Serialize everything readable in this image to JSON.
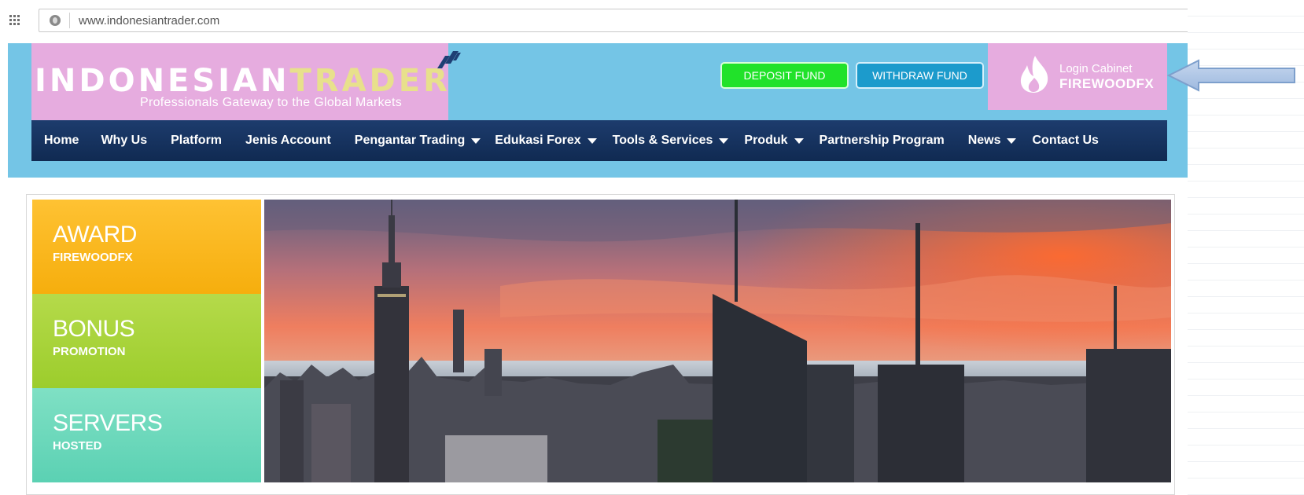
{
  "browser": {
    "url": "www.indonesiantrader.com"
  },
  "header": {
    "logo_part1": "INDONESIAN",
    "logo_part2": "TRADER",
    "tagline": "Professionals Gateway to the Global Markets",
    "deposit_label": "DEPOSIT FUND",
    "withdraw_label": "WITHDRAW FUND",
    "login_line1": "Login Cabinet",
    "login_line2": "FIREWOODFX"
  },
  "nav": {
    "items": [
      {
        "label": "Home"
      },
      {
        "label": "Why Us"
      },
      {
        "label": "Platform"
      },
      {
        "label": "Jenis Account"
      },
      {
        "label": "Pengantar Trading"
      },
      {
        "label": "Edukasi Forex"
      },
      {
        "label": "Tools & Services"
      },
      {
        "label": "Produk"
      },
      {
        "label": "Partnership Program"
      },
      {
        "label": "News"
      },
      {
        "label": "Contact Us"
      }
    ]
  },
  "tiles": [
    {
      "title": "AWARD",
      "subtitle": "FIREWOODFX"
    },
    {
      "title": "BONUS",
      "subtitle": "PROMOTION"
    },
    {
      "title": "SERVERS",
      "subtitle": "HOSTED"
    }
  ],
  "colors": {
    "header_bg": "#74c5e6",
    "logo_bg": "#e6acdf",
    "nav_bg": "#173463",
    "deposit": "#21e22a",
    "withdraw": "#1c9bcc",
    "award": "#fec233",
    "bonus": "#b5da4a",
    "servers": "#7fe0c4"
  },
  "icons": {
    "apps": "apps-grid-icon",
    "site": "globe-icon",
    "login": "flame-icon",
    "annotation": "arrow-left-icon"
  }
}
